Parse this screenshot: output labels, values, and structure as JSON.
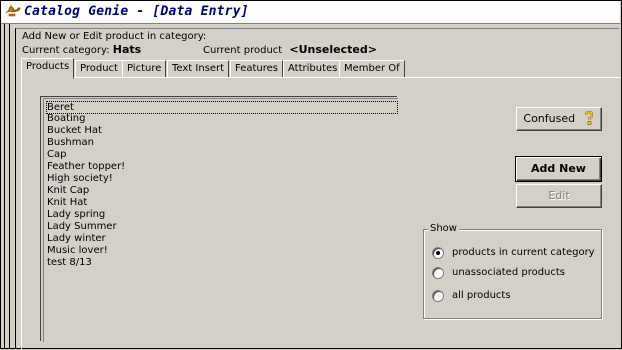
{
  "window": {
    "title": "Catalog Genie - [Data Entry]"
  },
  "header": {
    "instruction": "Add New or Edit product in category:",
    "current_category_label": "Current category:",
    "current_category_value": "Hats",
    "current_product_label": "Current product",
    "current_product_value": "<Unselected>"
  },
  "tabs": [
    {
      "label": "Products",
      "active": true
    },
    {
      "label": "Product",
      "active": false
    },
    {
      "label": "Picture",
      "active": false
    },
    {
      "label": "Text Insert",
      "active": false
    },
    {
      "label": "Features",
      "active": false
    },
    {
      "label": "Attributes",
      "active": false
    },
    {
      "label": "Member Of",
      "active": false
    }
  ],
  "product_list": {
    "items": [
      "Beret",
      "Boating",
      "Bucket  Hat",
      "Bushman",
      "Cap",
      "Feather topper!",
      "High society!",
      "Knit Cap",
      "Knit Hat",
      "Lady spring",
      "Lady Summer",
      "Lady winter",
      "Music lover!",
      "test 8/13"
    ],
    "focused_index": 0
  },
  "buttons": {
    "confused": "Confused",
    "add_new": "Add New",
    "edit": "Edit"
  },
  "show_group": {
    "label": "Show",
    "options": [
      "products in current category",
      "unassociated products",
      "all products"
    ],
    "selected_index": 0
  },
  "icons": {
    "title": "genie-lamp-icon",
    "confused": "question-key-icon"
  },
  "colors": {
    "title_text": "#000080",
    "face": "#d4d0c8"
  }
}
